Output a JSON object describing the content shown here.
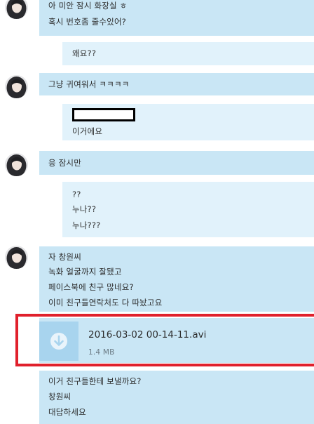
{
  "colors": {
    "incoming_bubble": "#c9e6f5",
    "outgoing_bubble": "#e1f2fb",
    "highlight": "#e0202c",
    "download_icon_bg": "#a8d4ee"
  },
  "messages": [
    {
      "direction": "incoming",
      "lines": [
        "아 미안 잠시 화장실 ㅎ",
        "혹시 번호좀 줄수있어?"
      ]
    },
    {
      "direction": "outgoing",
      "lines": [
        "왜요??"
      ]
    },
    {
      "direction": "incoming",
      "lines": [
        "그냥 귀여워서 ㅋㅋㅋㅋ"
      ]
    },
    {
      "direction": "outgoing",
      "lines": [
        "이거에요"
      ]
    },
    {
      "direction": "incoming",
      "lines": [
        "응 잠시만"
      ]
    },
    {
      "direction": "outgoing",
      "lines": [
        "??",
        "누나??",
        "누나???"
      ]
    },
    {
      "direction": "incoming",
      "lines": [
        "자 창원씨",
        "녹화 얼굴까지 잘됐고",
        "페이스북에 친구 많네요?",
        "이미 친구들연락처도 다 따놨고요"
      ]
    },
    {
      "direction": "incoming",
      "lines": [
        "이거 친구들한테 보낼까요?",
        "창원씨",
        "대답하세요"
      ]
    }
  ],
  "attachment": {
    "filename": "2016-03-02 00-14-11.avi",
    "size": "1.4 MB",
    "icon": "download-icon"
  }
}
